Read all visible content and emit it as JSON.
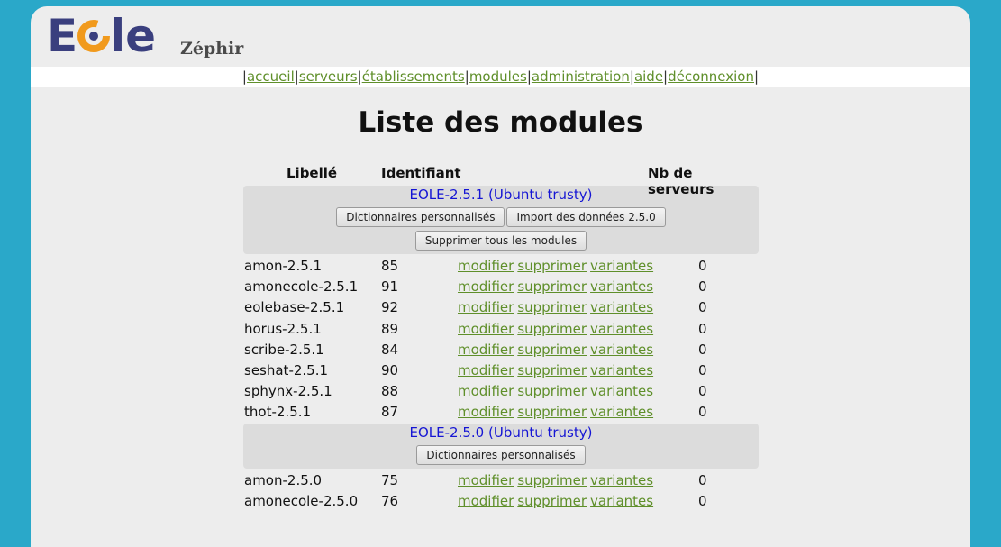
{
  "app": {
    "logo_text": "EOLE",
    "title": "Zéphir"
  },
  "nav": {
    "items": [
      "accueil",
      "serveurs",
      "établissements",
      "modules",
      "administration",
      "aide",
      "déconnexion"
    ],
    "separator": "|"
  },
  "page_title": "Liste des modules",
  "table": {
    "headers": {
      "libelle": "Libellé",
      "identifiant": "Identifiant",
      "nb_serveurs": "Nb de serveurs"
    },
    "action_labels": {
      "modify": "modifier",
      "delete": "supprimer",
      "variants": "variantes"
    },
    "groups": [
      {
        "title": "EOLE-2.5.1 (Ubuntu trusty)",
        "buttons": [
          "Dictionnaires personnalisés",
          "Import des données 2.5.0"
        ],
        "buttons_row2": [
          "Supprimer tous les modules"
        ],
        "modules": [
          {
            "name": "amon-2.5.1",
            "id": "85",
            "count": "0"
          },
          {
            "name": "amonecole-2.5.1",
            "id": "91",
            "count": "0"
          },
          {
            "name": "eolebase-2.5.1",
            "id": "92",
            "count": "0"
          },
          {
            "name": "horus-2.5.1",
            "id": "89",
            "count": "0"
          },
          {
            "name": "scribe-2.5.1",
            "id": "84",
            "count": "0"
          },
          {
            "name": "seshat-2.5.1",
            "id": "90",
            "count": "0"
          },
          {
            "name": "sphynx-2.5.1",
            "id": "88",
            "count": "0"
          },
          {
            "name": "thot-2.5.1",
            "id": "87",
            "count": "0"
          }
        ]
      },
      {
        "title": "EOLE-2.5.0 (Ubuntu trusty)",
        "buttons": [
          "Dictionnaires personnalisés"
        ],
        "buttons_row2": [],
        "modules": [
          {
            "name": "amon-2.5.0",
            "id": "75",
            "count": "0"
          },
          {
            "name": "amonecole-2.5.0",
            "id": "76",
            "count": "0"
          }
        ]
      }
    ]
  },
  "colors": {
    "background": "#2aa8c9",
    "link": "#5f8f2a",
    "group_title": "#1515d4",
    "logo_purple": "#3a3f7e",
    "logo_orange": "#f19a1d"
  }
}
